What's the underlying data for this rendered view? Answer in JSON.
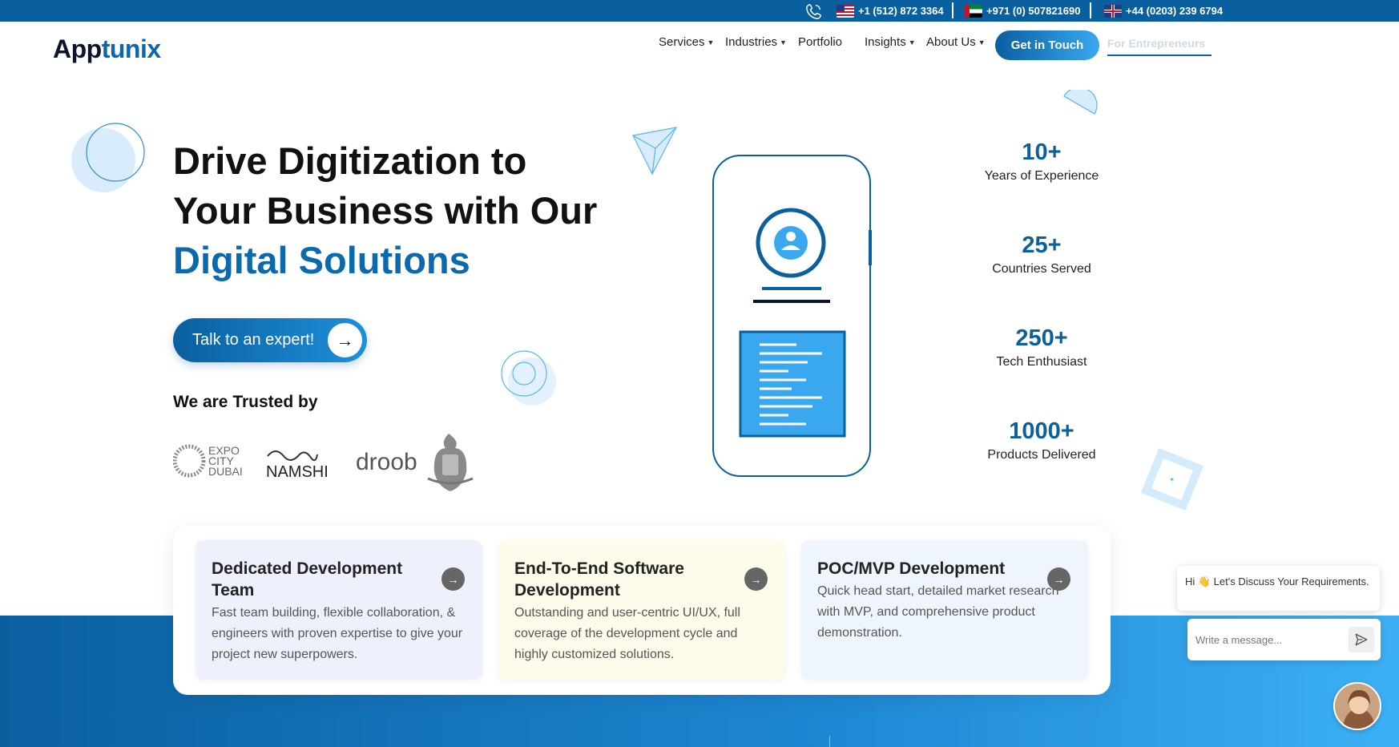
{
  "topbar": {
    "phones": [
      {
        "country": "US",
        "number": "+1 (512) 872 3364"
      },
      {
        "country": "UAE",
        "number": "+971 (0) 507821690"
      },
      {
        "country": "UK",
        "number": "+44 (0203) 239 6794"
      }
    ]
  },
  "header": {
    "logo_a": "A",
    "logo_pp": "pp",
    "logo_tunix": "tunix",
    "nav": [
      "Services",
      "Industries",
      "Portfolio",
      "Insights",
      "About Us"
    ],
    "cta": "Get in Touch",
    "entrepreneurs": "For Entrepreneurs"
  },
  "hero": {
    "title_line1": "Drive Digitization to",
    "title_line2": "Your Business with Our",
    "title_line3": "Digital Solutions",
    "button": "Talk to an expert!",
    "trusted": "We are Trusted by",
    "clients": [
      "EXPO CITY DUBAI",
      "NAMSHI",
      "droob"
    ]
  },
  "stats": [
    {
      "value": "10+",
      "label": "Years of Experience"
    },
    {
      "value": "25+",
      "label": "Countries Served"
    },
    {
      "value": "250+",
      "label": "Tech Enthusiast"
    },
    {
      "value": "1000+",
      "label": "Products Delivered"
    }
  ],
  "cards": [
    {
      "title": "Dedicated Development Team",
      "desc": "Fast team building, flexible collaboration, & engineers with proven expertise to give your project new superpowers.",
      "bg": "#eef0fb"
    },
    {
      "title": "End-To-End Software Development",
      "desc": "Outstanding and user-centric UI/UX, full coverage of the development cycle and highly customized solutions.",
      "bg": "#fdfbea"
    },
    {
      "title": "POC/MVP Development",
      "desc": "Quick head start, detailed market research with MVP, and comprehensive product demonstration.",
      "bg": "#eef5fc"
    }
  ],
  "chat": {
    "greeting": "Hi 👋 Let's Discuss Your Requirements.",
    "placeholder": "Write a message..."
  },
  "colors": {
    "brand": "#0a5f9f",
    "accent": "#39a8f0"
  }
}
